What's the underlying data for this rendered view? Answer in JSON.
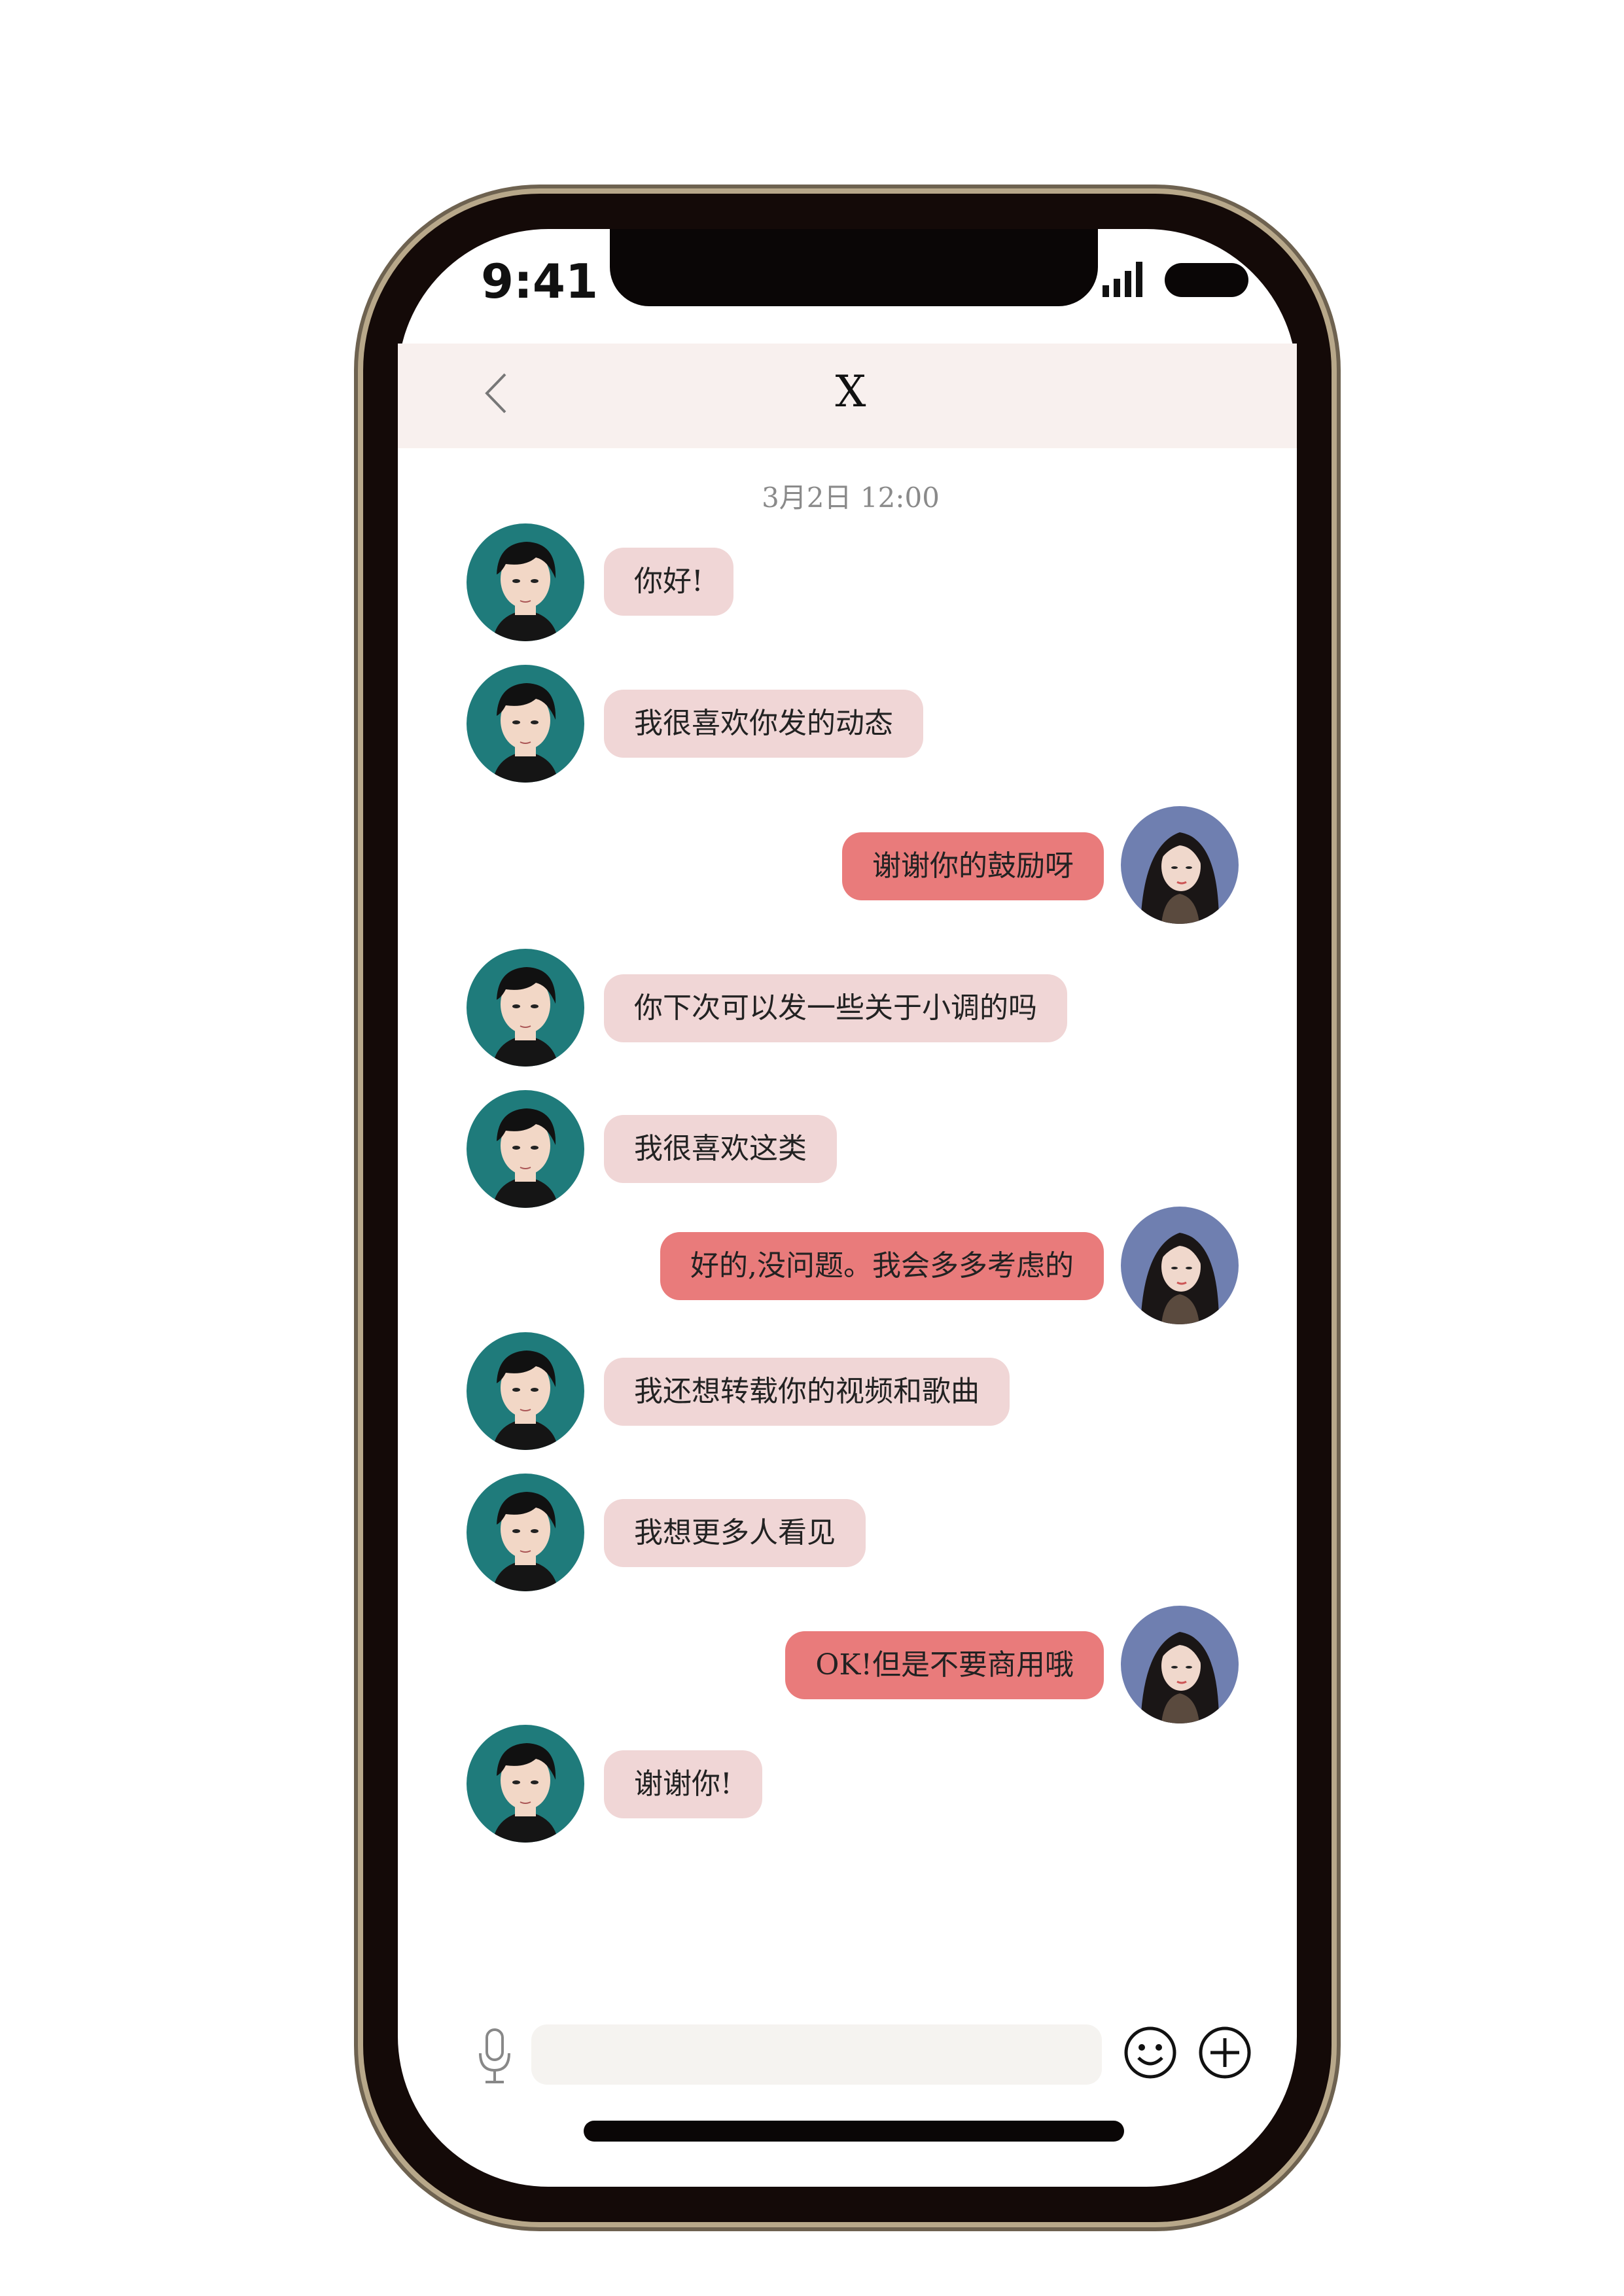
{
  "status_bar": {
    "time": "9:41"
  },
  "header": {
    "title": "X"
  },
  "chat": {
    "timestamp": "3月2日 12:00",
    "messages": [
      {
        "sender": "contact",
        "text": "你好!"
      },
      {
        "sender": "contact",
        "text": "我很喜欢你发的动态"
      },
      {
        "sender": "me",
        "text": "谢谢你的鼓励呀"
      },
      {
        "sender": "contact",
        "text": "你下次可以发一些关于小调的吗"
      },
      {
        "sender": "contact",
        "text": "我很喜欢这类"
      },
      {
        "sender": "me",
        "text": "好的,没问题。我会多多考虑的"
      },
      {
        "sender": "contact",
        "text": "我还想转载你的视频和歌曲"
      },
      {
        "sender": "contact",
        "text": "我想更多人看见"
      },
      {
        "sender": "me",
        "text": "OK!但是不要商用哦"
      },
      {
        "sender": "contact",
        "text": "谢谢你!"
      }
    ]
  },
  "input_bar": {
    "value": "",
    "placeholder": ""
  },
  "icons": {
    "back": "chevron-left-icon",
    "mic": "microphone-icon",
    "emoji": "smiley-icon",
    "add": "plus-circle-icon",
    "signal": "signal-bars-icon",
    "battery": "battery-icon"
  },
  "colors": {
    "incoming_bubble": "#f0d6d6",
    "outgoing_bubble": "#e97b7b",
    "header_bg": "#f8f0ee",
    "frame": "#140a08",
    "contact_avatar_bg": "#1f7b7b",
    "self_avatar_bg": "#6f7fb0"
  }
}
